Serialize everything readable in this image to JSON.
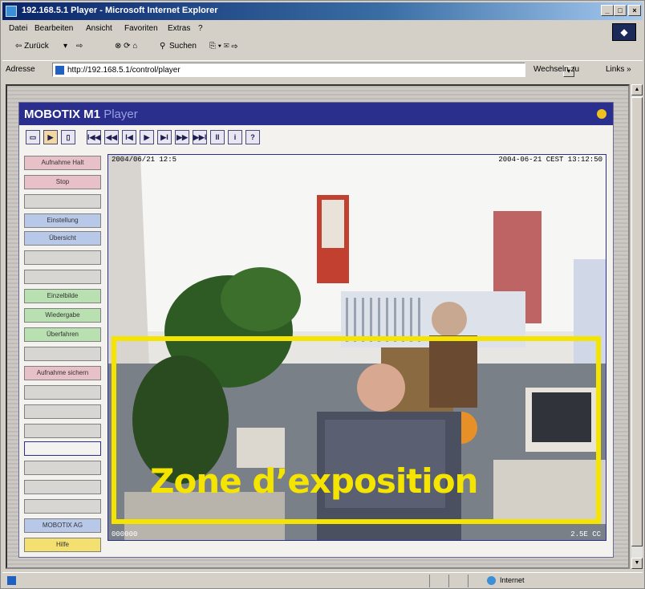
{
  "window": {
    "title": "192.168.5.1 Player - Microsoft Internet Explorer",
    "minimize": "_",
    "maximize": "□",
    "close": "×"
  },
  "menu": {
    "items": [
      "Datei",
      "Bearbeiten",
      "Ansicht",
      "Favoriten",
      "Extras",
      "?"
    ]
  },
  "toolbar": {
    "back": "⇦ Zurück",
    "back_dd": "▾",
    "forward": "⇨",
    "search": "Suchen",
    "history_icons": "⎘ ▾ ✉ ⇨"
  },
  "address": {
    "label": "Adresse",
    "url": "http://192.168.5.1/control/player",
    "go": "Wechseln zu",
    "links": "Links »"
  },
  "player": {
    "brand": "MOBOTIX M1",
    "brand_sub": "Player",
    "tools_left": [
      "▭",
      "▶",
      "▯"
    ],
    "tools_main": [
      "I◀◀",
      "◀◀",
      "I◀",
      "▶",
      "▶I",
      "▶▶",
      "▶▶I",
      "II",
      "i",
      "?"
    ],
    "sidebar": [
      {
        "label": "Aufnahme Halt",
        "color": "pink"
      },
      {
        "label": "Stop",
        "color": "pink"
      },
      {
        "label": "",
        "color": "grey"
      },
      {
        "label": "Einstellung",
        "color": "blue"
      },
      {
        "label": "Übersicht",
        "color": "blue"
      },
      {
        "label": "",
        "color": "grey"
      },
      {
        "label": "",
        "color": "grey"
      },
      {
        "label": "Einzelbilde",
        "color": "green"
      },
      {
        "label": "Wiedergabe",
        "color": "green"
      },
      {
        "label": "Überfahren",
        "color": "green"
      },
      {
        "label": "",
        "color": "grey"
      },
      {
        "label": "Aufnahme sichern",
        "color": "pink"
      },
      {
        "label": "",
        "color": "grey"
      },
      {
        "label": "",
        "color": "grey"
      },
      {
        "label": "",
        "color": "grey"
      },
      {
        "label": "",
        "color": "white"
      },
      {
        "label": "",
        "color": "grey"
      },
      {
        "label": "",
        "color": "grey"
      },
      {
        "label": "",
        "color": "grey"
      },
      {
        "label": "MOBOTIX AG",
        "color": "blue"
      },
      {
        "label": "Hilfe",
        "color": "yellow"
      }
    ],
    "video": {
      "timestamp_left": "2004/06/21 12:5",
      "timestamp_right": "2004-06-21 CEST 13:12:50",
      "frame_left": "000000",
      "frame_right": "2.5E CC"
    }
  },
  "overlay": {
    "zone_label": "Zone d’exposition",
    "zone_color": "#f4e400"
  },
  "status": {
    "zone": "Internet"
  }
}
